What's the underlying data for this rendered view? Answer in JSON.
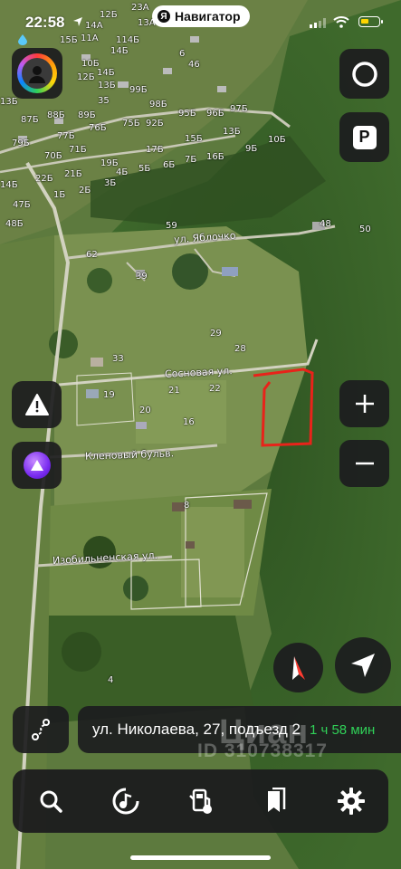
{
  "status_bar": {
    "time": "22:58"
  },
  "app_pill": {
    "logo": "Я",
    "title": "Навигатор"
  },
  "map": {
    "streets": {
      "yablochko": "ул. Яблочко",
      "sosnovaya": "Сосновая ул.",
      "klenovy": "Кленовый бульв.",
      "izobil": "Изобильненская ул."
    },
    "house_numbers": {
      "n59": "59",
      "n48": "48",
      "n50": "50",
      "n62": "62",
      "n39": "39",
      "n29": "29",
      "n28": "28",
      "n33": "33",
      "n19": "19",
      "n21": "21",
      "n22": "22",
      "n20": "20",
      "n16": "16",
      "n8": "8",
      "n4": "4",
      "n23a": "23А",
      "n12b": "12Б",
      "n13a": "13А",
      "n14a": "14А",
      "n15b": "15Б",
      "n14b": "14Б",
      "n11a": "11А",
      "n10b": "10Б",
      "n12b2": "12Б",
      "n14b2": "14Б",
      "n13b": "13Б",
      "n99b": "99Б",
      "n98b": "98Б",
      "n87b": "87Б",
      "n88b": "88Б",
      "n89b": "89Б",
      "n95b": "95Б",
      "n96b": "96Б",
      "n97b": "97Б",
      "n77b": "77Б",
      "n76b": "76Б",
      "n75b": "75Б",
      "n92b": "92Б",
      "n13b2": "13Б",
      "n15b2": "15Б",
      "n79b": "79Б",
      "n71b": "71Б",
      "n17b": "17Б",
      "n16b": "16Б",
      "n9b": "9Б",
      "n10b2": "10Б",
      "n70b": "70Б",
      "n7b": "7Б",
      "n6b": "6Б",
      "n5b": "5Б",
      "n4b": "4Б",
      "n22b": "22Б",
      "n21b": "21Б",
      "n19b": "19Б",
      "n3b": "3Б",
      "n1b": "1Б",
      "n2b": "2Б",
      "n47b": "47Б",
      "n48b": "48Б",
      "n13b3": "13Б",
      "n46": "46",
      "n6": "6",
      "n114b": "114Б",
      "n14b3": "14Б",
      "n35": "35"
    }
  },
  "address_bar": {
    "address": "ул. Николаева, 27, подъезд 2",
    "eta": "1 ч 58 мин"
  },
  "watermark": {
    "line1": "Циан",
    "line2": "ID 310738317"
  },
  "icons": {
    "location_arrow": "location-arrow-icon",
    "water_drop": "water-drop-icon",
    "signal": "cellular-signal-icon",
    "wifi": "wifi-icon",
    "battery": "battery-icon",
    "alice": "alice-icon",
    "warning": "warning-icon",
    "plus": "plus-icon",
    "minus": "minus-icon",
    "compass": "compass-icon",
    "locate": "navigation-arrow-icon",
    "route": "route-icon",
    "search": "search-icon",
    "music": "music-icon",
    "gas": "gas-station-icon",
    "bookmarks": "bookmarks-icon",
    "settings": "gear-icon",
    "parking": "parking-icon",
    "circle": "circle-icon"
  },
  "colors": {
    "eta": "#30d158",
    "marker": "#e8231a",
    "toolbar_bg": "#1c1c1e"
  }
}
